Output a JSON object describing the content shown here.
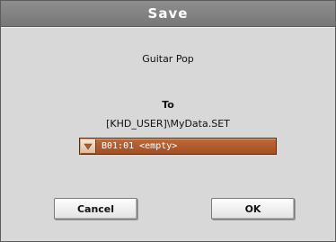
{
  "dialog": {
    "title": "Save",
    "item_name": "Guitar Pop",
    "to_label": "To",
    "destination_path": "[KHD_USER]\\MyData.SET",
    "destination_dropdown": {
      "selected_value": "B01:01 <empty>",
      "icon": "triangle-down-icon"
    },
    "buttons": {
      "cancel_label": "Cancel",
      "ok_label": "OK"
    }
  },
  "colors": {
    "title_bar": "#7f7f7f",
    "body": "#d8d8d8",
    "dropdown_fill": "#b45d2e",
    "dropdown_text": "#ffffff"
  }
}
